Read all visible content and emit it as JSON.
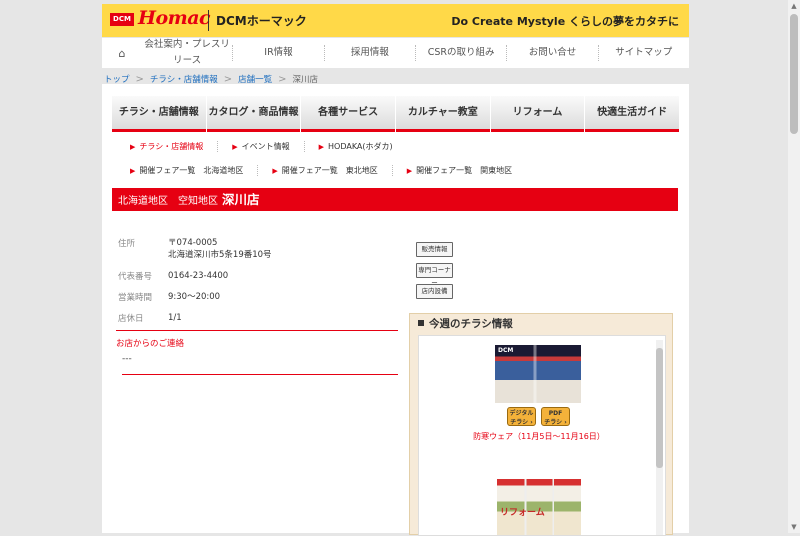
{
  "header": {
    "logo_dcm": "DCM",
    "logo_homac": "Homac",
    "logo_sub": "DCMホーマック",
    "tagline": "Do Create Mystyle  くらしの夢をカタチに"
  },
  "global_nav": {
    "home_icon": "⌂",
    "items": [
      "会社案内・プレスリリース",
      "IR情報",
      "採用情報",
      "CSRの取り組み",
      "お問い合せ",
      "サイトマップ"
    ]
  },
  "breadcrumb": {
    "items": [
      "トップ",
      "チラシ・店舗情報",
      "店舗一覧"
    ],
    "separator": ">",
    "current": "深川店"
  },
  "category_nav": [
    "チラシ・店舗情報",
    "カタログ・商品情報",
    "各種サービス",
    "カルチャー教室",
    "リフォーム",
    "快適生活ガイド"
  ],
  "sub_nav_1": [
    "チラシ・店舗情報",
    "イベント情報",
    "HODAKA(ホダカ)"
  ],
  "sub_nav_2": [
    "開催フェア一覧　北海道地区",
    "開催フェア一覧　東北地区",
    "開催フェア一覧　関東地区"
  ],
  "store_header": {
    "region": "北海道地区　空知地区",
    "store_name": "深川店"
  },
  "store_info": {
    "address_label": "住所",
    "postal": "〒074-0005",
    "address": "北海道深川市5条19番10号",
    "phone_label": "代表番号",
    "phone": "0164-23-4400",
    "hours_label": "営業時間",
    "hours": "9:30～20:00",
    "closed_label": "店休日",
    "closed": "1/1"
  },
  "notice": {
    "title": "お店からのご連絡",
    "body": "---"
  },
  "side_buttons": [
    "販売情報",
    "専門コーナー",
    "店内設備"
  ],
  "flyer": {
    "title": "今週のチラシ情報",
    "digital_btn": [
      "デジタル",
      "チラシ ›"
    ],
    "pdf_btn": [
      "PDF",
      "チラシ ›"
    ],
    "caption": "防寒ウェア（11月5日～11月16日）",
    "thumb1_label": "DCM",
    "thumb2_label": "リフォーム"
  },
  "colors": {
    "brand_yellow": "#ffd948",
    "brand_red": "#e60012",
    "link_blue": "#1f6fbf"
  }
}
